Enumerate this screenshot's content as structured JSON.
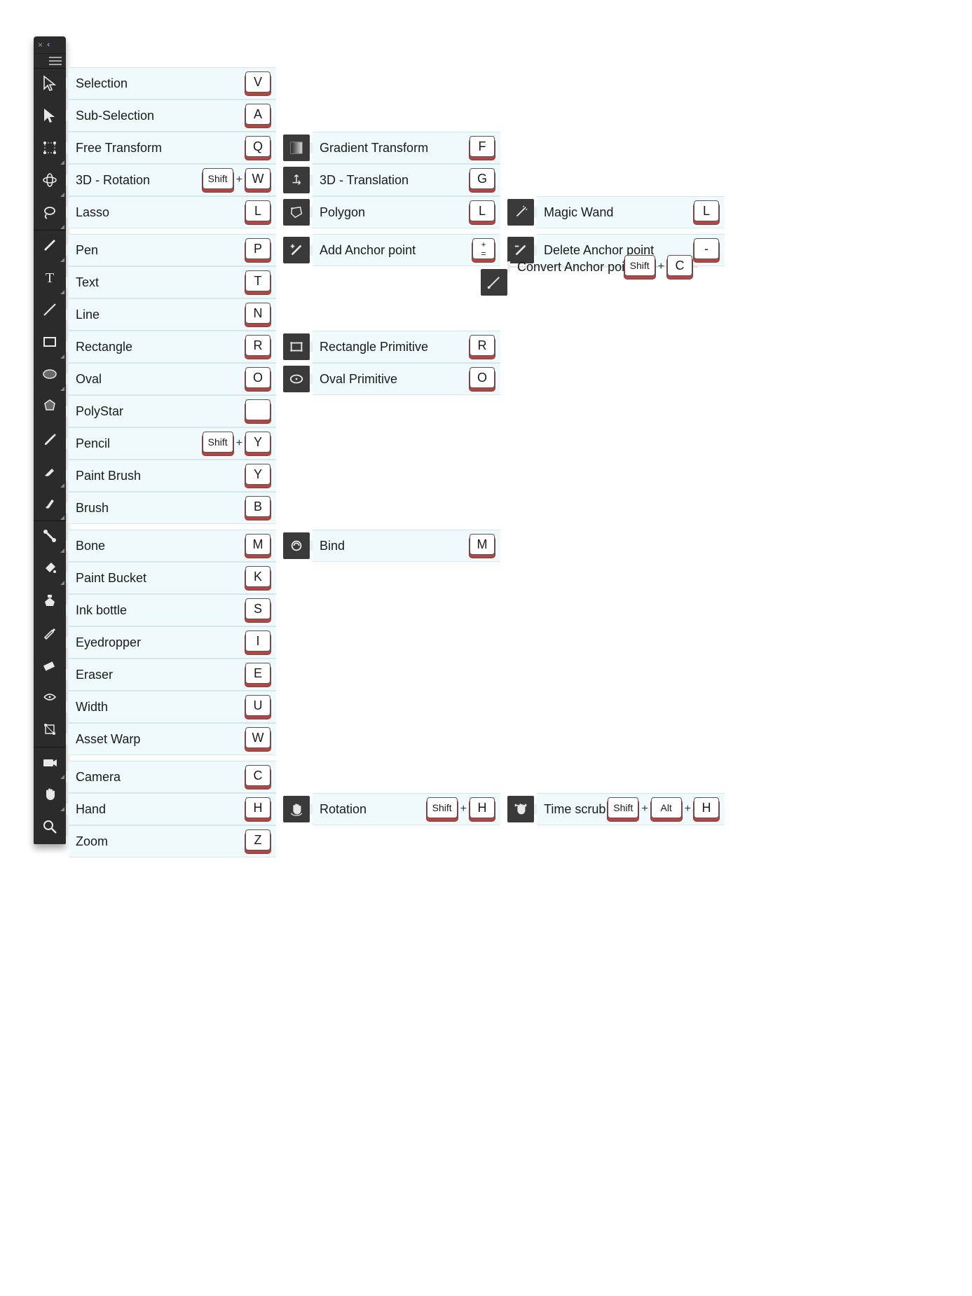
{
  "panel": {
    "close": "×",
    "collapse": "‹‹",
    "menu": "≡"
  },
  "modifiers": {
    "shift": "Shift",
    "alt": "Alt"
  },
  "special_keys": {
    "plus_equals_top": "+",
    "plus_equals_bottom": "=",
    "minus": "-"
  },
  "groups": [
    {
      "tools": [
        {
          "id": "selection",
          "icon": "cursor-arrow-icon",
          "label": "Selection",
          "key": "V",
          "more": false
        },
        {
          "id": "subselection",
          "icon": "cursor-arrow-solid-icon",
          "label": "Sub-Selection",
          "key": "A",
          "more": false
        },
        {
          "id": "free-transform",
          "icon": "free-transform-icon",
          "label": "Free Transform",
          "key": "Q",
          "more": true,
          "alts": [
            {
              "id": "gradient-transform",
              "icon": "gradient-transform-icon",
              "label": "Gradient Transform",
              "key": "F"
            }
          ]
        },
        {
          "id": "rotation-3d",
          "icon": "rotation-3d-icon",
          "label": "3D - Rotation",
          "mods": [
            "shift"
          ],
          "key": "W",
          "more": true,
          "alts": [
            {
              "id": "translation-3d",
              "icon": "translation-3d-icon",
              "label": "3D - Translation",
              "key": "G"
            }
          ]
        },
        {
          "id": "lasso",
          "icon": "lasso-icon",
          "label": "Lasso",
          "key": "L",
          "more": true,
          "alts": [
            {
              "id": "polygon-lasso",
              "icon": "polygon-lasso-icon",
              "label": "Polygon",
              "key": "L"
            },
            {
              "id": "magic-wand",
              "icon": "magic-wand-icon",
              "label": "Magic Wand",
              "key": "L"
            }
          ]
        }
      ]
    },
    {
      "tools": [
        {
          "id": "pen",
          "icon": "pen-icon",
          "label": "Pen",
          "key": "P",
          "more": true,
          "alts": [
            {
              "id": "add-anchor",
              "icon": "pen-add-icon",
              "label": "Add Anchor point",
              "special_key": "plus_equals"
            },
            {
              "id": "delete-anchor",
              "icon": "pen-delete-icon",
              "label": "Delete Anchor point",
              "special_key": "minus"
            },
            {
              "id": "convert-anchor",
              "icon": "convert-anchor-icon",
              "label": "Convert Anchor point",
              "mods": [
                "shift"
              ],
              "key": "C",
              "row_below": true
            }
          ]
        },
        {
          "id": "text",
          "icon": "text-icon",
          "label": "Text",
          "key": "T",
          "more": true
        },
        {
          "id": "line",
          "icon": "line-icon",
          "label": "Line",
          "key": "N",
          "more": false
        },
        {
          "id": "rectangle",
          "icon": "rectangle-icon",
          "label": "Rectangle",
          "key": "R",
          "more": true,
          "alts": [
            {
              "id": "rectangle-primitive",
              "icon": "rectangle-primitive-icon",
              "label": "Rectangle Primitive",
              "key": "R"
            }
          ]
        },
        {
          "id": "oval",
          "icon": "oval-icon",
          "label": "Oval",
          "key": "O",
          "more": true,
          "alts": [
            {
              "id": "oval-primitive",
              "icon": "oval-primitive-icon",
              "label": "Oval Primitive",
              "key": "O"
            }
          ]
        },
        {
          "id": "polystar",
          "icon": "polystar-icon",
          "label": "PolyStar",
          "key": "",
          "more": false
        },
        {
          "id": "pencil",
          "icon": "pencil-icon",
          "label": "Pencil",
          "mods": [
            "shift"
          ],
          "key": "Y",
          "more": false
        },
        {
          "id": "paint-brush",
          "icon": "paint-brush-icon",
          "label": "Paint Brush",
          "key": "Y",
          "more": true
        },
        {
          "id": "brush",
          "icon": "brush-icon",
          "label": "Brush",
          "key": "B",
          "more": true
        }
      ]
    },
    {
      "tools": [
        {
          "id": "bone",
          "icon": "bone-icon",
          "label": "Bone",
          "key": "M",
          "more": true,
          "alts": [
            {
              "id": "bind",
              "icon": "bind-icon",
              "label": "Bind",
              "key": "M"
            }
          ]
        },
        {
          "id": "paint-bucket",
          "icon": "paint-bucket-icon",
          "label": "Paint Bucket",
          "key": "K",
          "more": true
        },
        {
          "id": "ink-bottle",
          "icon": "ink-bottle-icon",
          "label": "Ink bottle",
          "key": "S",
          "more": false
        },
        {
          "id": "eyedropper",
          "icon": "eyedropper-icon",
          "label": "Eyedropper",
          "key": "I",
          "more": false
        },
        {
          "id": "eraser",
          "icon": "eraser-icon",
          "label": "Eraser",
          "key": "E",
          "more": false
        },
        {
          "id": "width",
          "icon": "width-icon",
          "label": "Width",
          "key": "U",
          "more": false
        },
        {
          "id": "asset-warp",
          "icon": "asset-warp-icon",
          "label": "Asset Warp",
          "key": "W",
          "more": false
        }
      ]
    },
    {
      "tools": [
        {
          "id": "camera",
          "icon": "camera-icon",
          "label": "Camera",
          "key": "C",
          "more": true
        },
        {
          "id": "hand",
          "icon": "hand-icon",
          "label": "Hand",
          "key": "H",
          "more": true,
          "alts": [
            {
              "id": "rotation-view",
              "icon": "rotation-view-icon",
              "label": "Rotation",
              "mods": [
                "shift"
              ],
              "key": "H"
            },
            {
              "id": "time-scrub",
              "icon": "time-scrub-icon",
              "label": "Time scrub",
              "mods": [
                "shift",
                "alt"
              ],
              "key": "H"
            }
          ]
        },
        {
          "id": "zoom",
          "icon": "zoom-icon",
          "label": "Zoom",
          "key": "Z",
          "more": false
        }
      ]
    }
  ]
}
